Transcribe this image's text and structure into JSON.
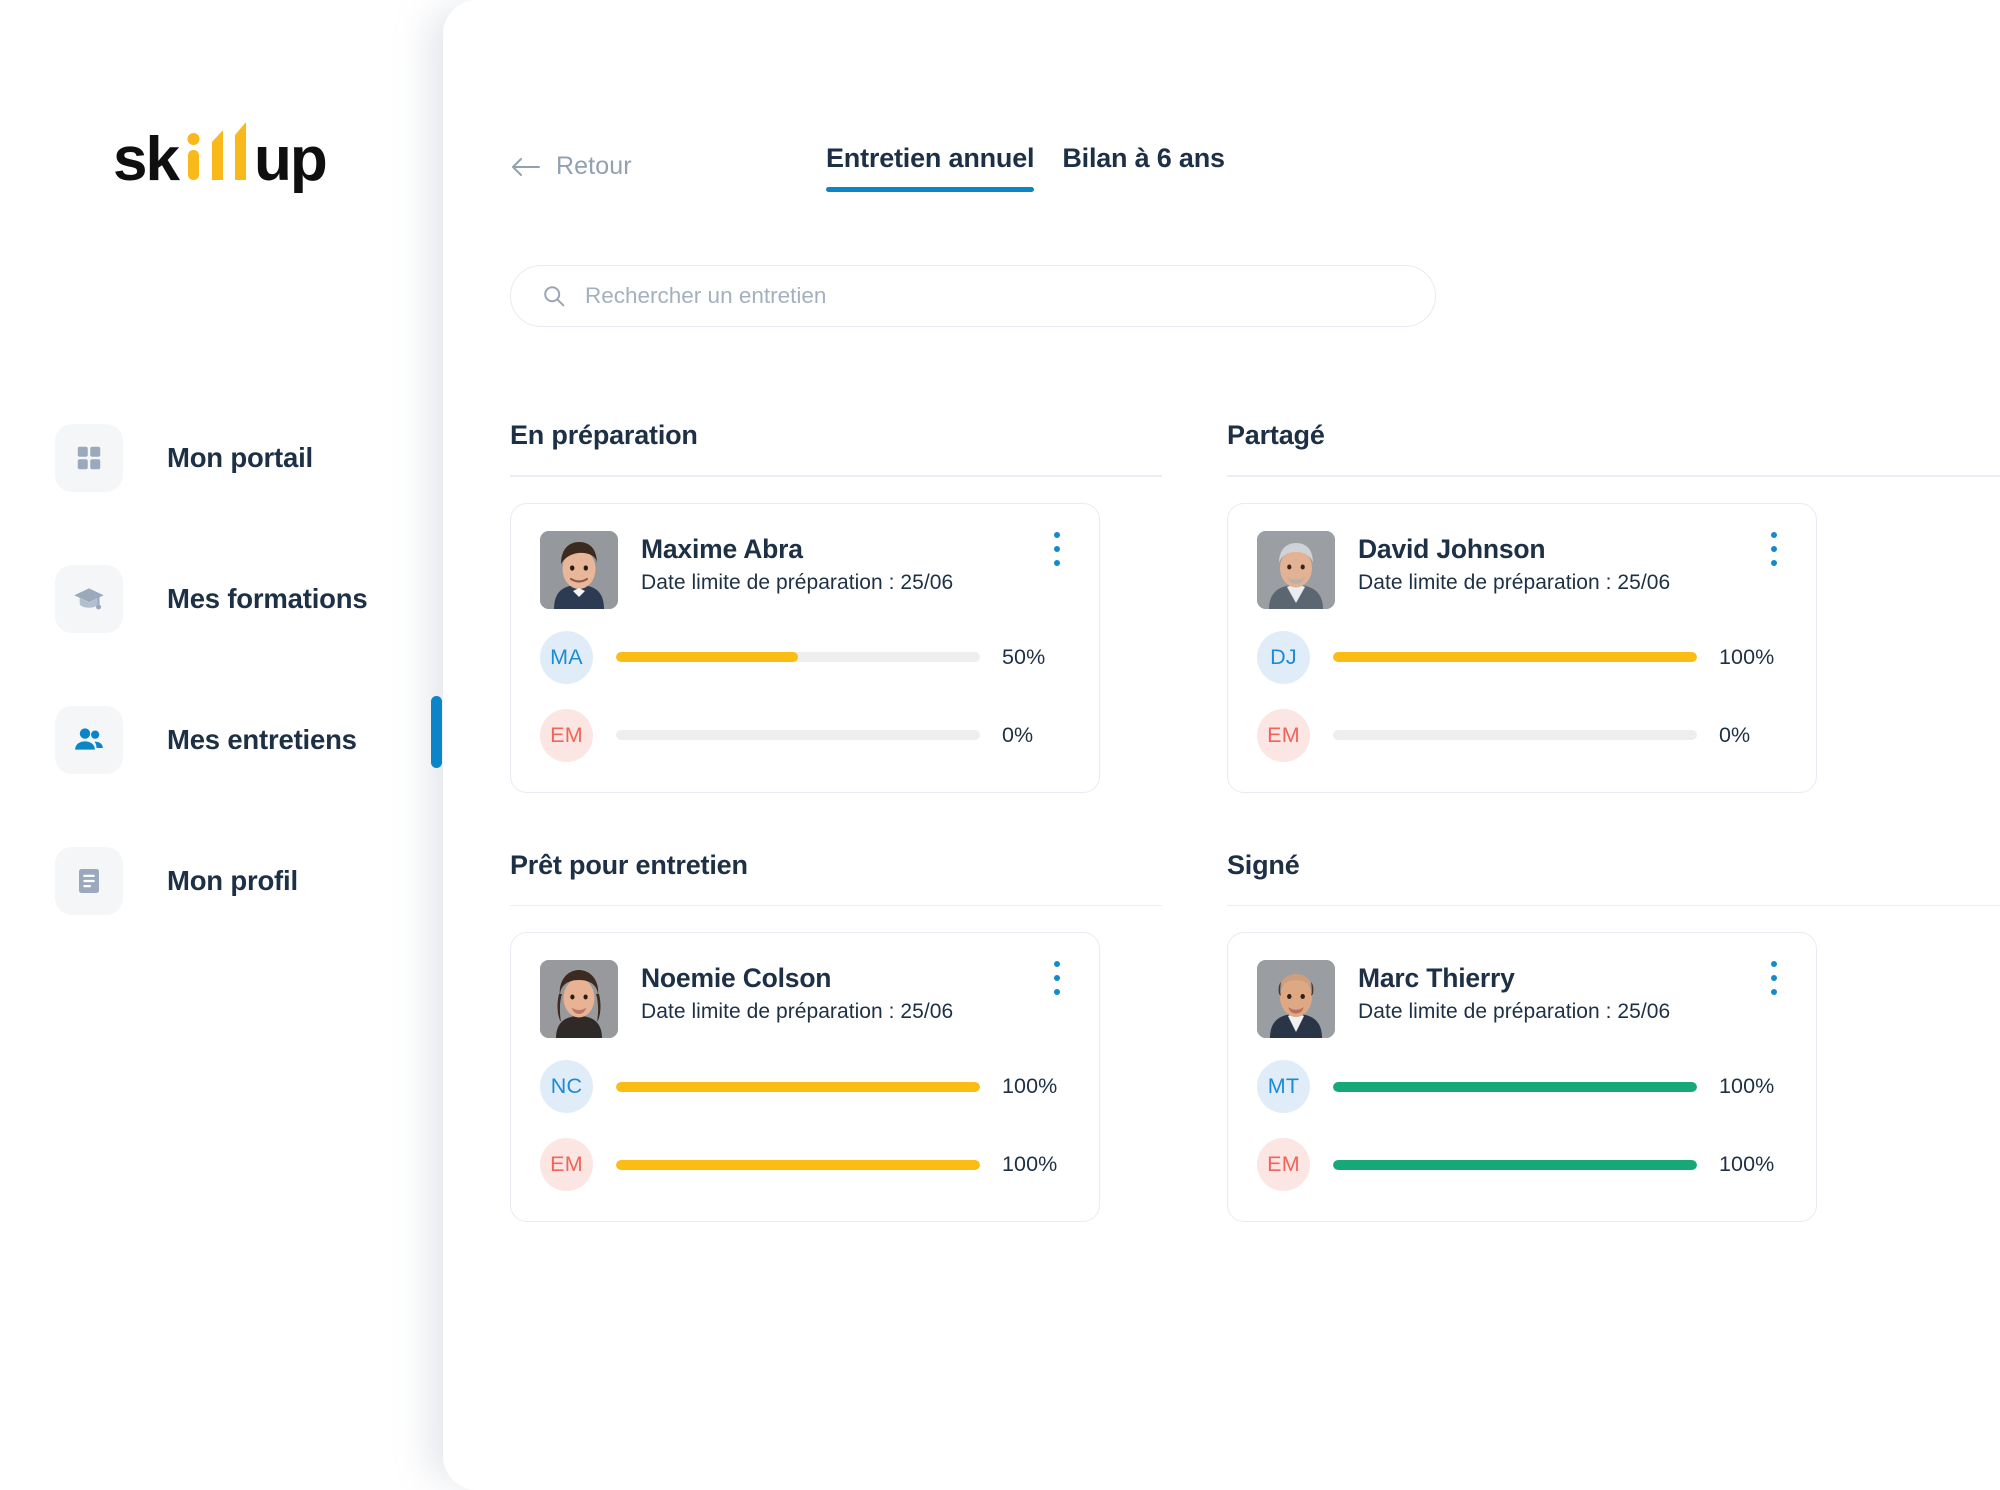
{
  "brand": {
    "logo_text_part1": "sk",
    "logo_text_part2": "up",
    "logo_name": "skillup",
    "accent_blue": "#0c84c8",
    "accent_yellow": "#fbbd14",
    "accent_green": "#16a877",
    "text_navy": "#1d3045"
  },
  "sidebar": {
    "items": [
      {
        "label": "Mon portail",
        "icon": "grid-icon",
        "active": false
      },
      {
        "label": "Mes formations",
        "icon": "graduation-cap-icon",
        "active": false
      },
      {
        "label": "Mes entretiens",
        "icon": "users-icon",
        "active": true
      },
      {
        "label": "Mon profil",
        "icon": "document-icon",
        "active": false
      }
    ]
  },
  "header": {
    "back_label": "Retour",
    "tabs": [
      {
        "label": "Entretien annuel",
        "active": true
      },
      {
        "label": "Bilan à 6 ans",
        "active": false
      }
    ]
  },
  "search": {
    "placeholder": "Rechercher un entretien",
    "value": ""
  },
  "board": {
    "sections": [
      {
        "title": "En préparation",
        "cards": [
          {
            "name": "Maxime Abra",
            "deadline": "Date limite de préparation : 25/06",
            "photo": "male-dark-hair",
            "progress": [
              {
                "initials": "MA",
                "tone": "blue",
                "percent": 50,
                "percent_label": "50%",
                "color": "yellow"
              },
              {
                "initials": "EM",
                "tone": "pink",
                "percent": 0,
                "percent_label": "0%",
                "color": "yellow"
              }
            ]
          }
        ]
      },
      {
        "title": "Partagé",
        "cards": [
          {
            "name": "David Johnson",
            "deadline": "Date limite de préparation : 25/06",
            "photo": "male-grey-hair",
            "progress": [
              {
                "initials": "DJ",
                "tone": "blue",
                "percent": 100,
                "percent_label": "100%",
                "color": "yellow"
              },
              {
                "initials": "EM",
                "tone": "pink",
                "percent": 0,
                "percent_label": "0%",
                "color": "yellow"
              }
            ]
          }
        ]
      },
      {
        "title": "Prêt pour entretien",
        "cards": [
          {
            "name": "Noemie Colson",
            "deadline": "Date limite de préparation : 25/06",
            "photo": "female-brown-hair",
            "progress": [
              {
                "initials": "NC",
                "tone": "blue",
                "percent": 100,
                "percent_label": "100%",
                "color": "yellow"
              },
              {
                "initials": "EM",
                "tone": "pink",
                "percent": 100,
                "percent_label": "100%",
                "color": "yellow"
              }
            ]
          }
        ]
      },
      {
        "title": "Signé",
        "cards": [
          {
            "name": "Marc Thierry",
            "deadline": "Date limite de préparation : 25/06",
            "photo": "male-bald",
            "progress": [
              {
                "initials": "MT",
                "tone": "blue",
                "percent": 100,
                "percent_label": "100%",
                "color": "green"
              },
              {
                "initials": "EM",
                "tone": "pink",
                "percent": 100,
                "percent_label": "100%",
                "color": "green"
              }
            ]
          }
        ]
      }
    ]
  }
}
